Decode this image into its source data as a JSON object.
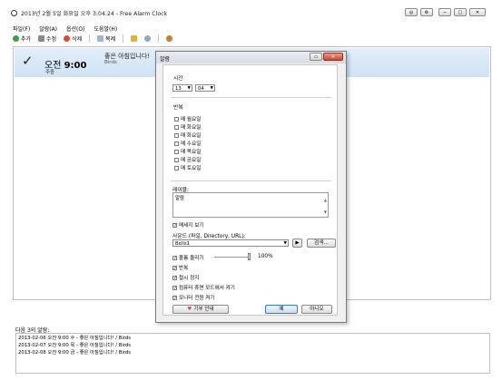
{
  "window": {
    "title": "2013년 2월 5일 화요일 오후 3:04:24 - Free Alarm Clock"
  },
  "menu": [
    "파일(F)",
    "알람(A)",
    "옵션(O)",
    "도움말(H)"
  ],
  "toolbar": {
    "add": "추가",
    "edit": "수정",
    "delete": "삭제",
    "copy": "복제"
  },
  "alarm": {
    "ampm": "오전",
    "time": "9:00",
    "message": "좋은 아침입니다!",
    "sound": "Birds",
    "repeat": "주중"
  },
  "next": {
    "label": "다음 3의 알람:",
    "items": [
      "2013-02-06 오전 9:00 수 - 좋은 아침입니다! / Birds",
      "2013-02-07 오전 9:00 목 - 좋은 아침입니다! / Birds",
      "2013-02-08 오전 9:00 금 - 좋은 아침입니다! / Birds"
    ]
  },
  "dialog": {
    "title": "알람",
    "time_label": "시간",
    "hour": "13",
    "minute": "04",
    "repeat_label": "반복",
    "days": [
      "매 월요일",
      "매 화요일",
      "매 화요일",
      "매 수요일",
      "매 목요일",
      "매 금요일",
      "매 토요일"
    ],
    "message_label": "레이블:",
    "message_value": "알람",
    "show_message": "메세지 보기",
    "sound_label": "사운드 (파일, Directory, URL):",
    "sound_value": "Bells1",
    "browse": "검색...",
    "volume_label": "볼륨 올리기",
    "volume_value": "100%",
    "volume_level": 0.95,
    "repeat_sound": "반복",
    "snooze": "절시 정지",
    "wake_pc": "컴퓨터 휴면 모드에서 켜기",
    "monitor_on": "모니터 전원 켜기",
    "donate": "기부 안내",
    "ok": "예",
    "cancel": "아니오"
  }
}
